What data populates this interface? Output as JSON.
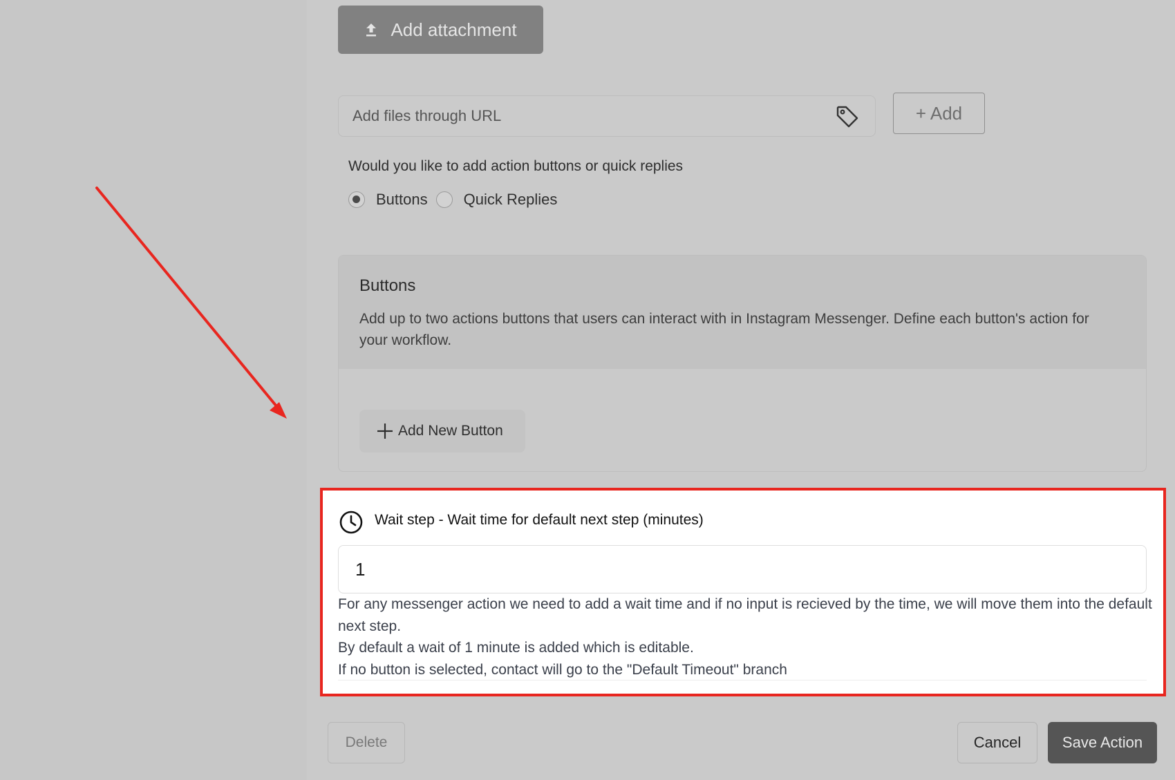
{
  "attachment": {
    "button_label": "Add attachment",
    "icon": "upload-icon"
  },
  "url_input": {
    "placeholder": "Add files through URL",
    "icon": "tag-icon"
  },
  "add_button": {
    "label": "+ Add"
  },
  "reply_type": {
    "question": "Would you like to add action buttons or quick replies",
    "options": [
      {
        "label": "Buttons",
        "selected": true
      },
      {
        "label": "Quick Replies",
        "selected": false
      }
    ]
  },
  "buttons_card": {
    "title": "Buttons",
    "description": "Add up to two actions buttons that users can interact with in Instagram Messenger. Define each button's action for your workflow.",
    "add_new_label": "Add New Button"
  },
  "wait_step": {
    "title": "Wait step - Wait time for default next step (minutes)",
    "icon": "clock-icon",
    "value": "1",
    "help_lines": [
      "For any messenger action we need to add a wait time and if no input is recieved by the time, we will move them into the default next step.",
      "By default a wait of 1 minute is added which is editable.",
      "If no button is selected, contact will go to the \"Default Timeout\" branch"
    ]
  },
  "footer": {
    "delete_label": "Delete",
    "cancel_label": "Cancel",
    "save_label": "Save Action"
  },
  "colors": {
    "highlight": "#e8261f",
    "primary_dark": "#555555"
  }
}
